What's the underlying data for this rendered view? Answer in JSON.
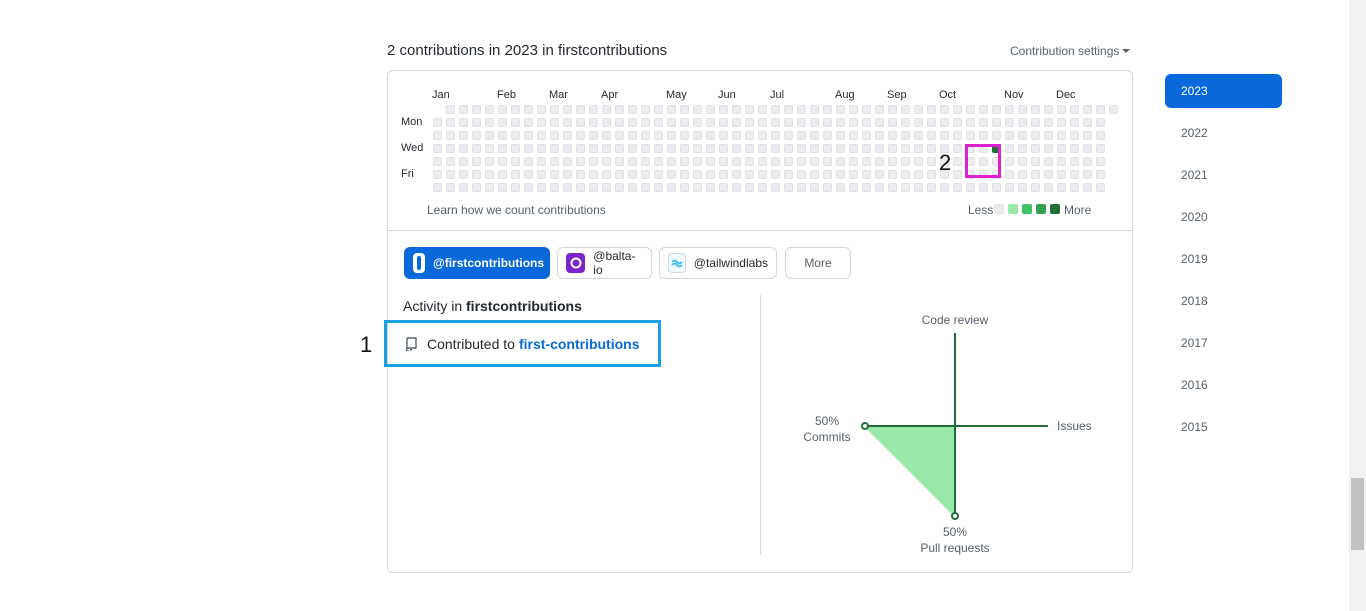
{
  "heading": "2 contributions in 2023 in firstcontributions",
  "settings_label": "Contribution settings",
  "calendar": {
    "months": [
      "Jan",
      "Feb",
      "Mar",
      "Apr",
      "May",
      "Jun",
      "Jul",
      "Aug",
      "Sep",
      "Oct",
      "Nov",
      "Dec"
    ],
    "day_labels": [
      "Mon",
      "Wed",
      "Fri"
    ],
    "active_day": {
      "week": 43,
      "weekday": "Wed",
      "level": 4
    },
    "learn_link": "Learn how we count contributions",
    "legend_less": "Less",
    "legend_more": "More",
    "legend_colors": [
      "#ebedf0",
      "#9be9a8",
      "#40c463",
      "#30a14e",
      "#216e39"
    ]
  },
  "orgs": [
    {
      "label": "@firstcontributions",
      "icon": "firstcontributions-logo-icon",
      "selected": true
    },
    {
      "label": "@balta-io",
      "icon": "balta-io-logo-icon",
      "selected": false
    },
    {
      "label": "@tailwindlabs",
      "icon": "tailwindlabs-logo-icon",
      "selected": false
    },
    {
      "label": "More",
      "selected": false
    }
  ],
  "activity": {
    "prefix": "Activity in",
    "org": "firstcontributions",
    "item_prefix": "Contributed to",
    "repo": "first-contributions"
  },
  "overview": {
    "code_review": "Code review",
    "issues": "Issues",
    "commits_pct": "50%",
    "commits": "Commits",
    "pull_requests_pct": "50%",
    "pull_requests": "Pull requests",
    "accent": "#216e39",
    "fill": "#9be9a8"
  },
  "years": [
    "2023",
    "2022",
    "2021",
    "2020",
    "2019",
    "2018",
    "2017",
    "2016",
    "2015"
  ],
  "selected_year": "2023",
  "annotations": {
    "one": "1",
    "two": "2"
  },
  "accent_color": "#0969da"
}
